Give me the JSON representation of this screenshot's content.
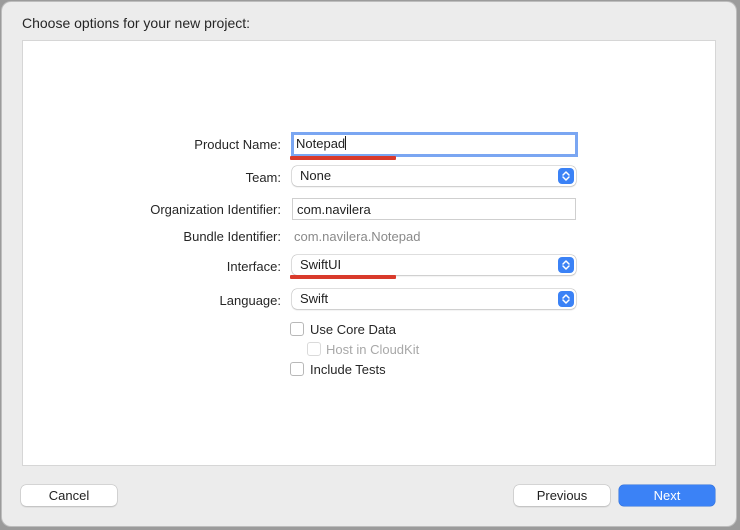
{
  "dialog": {
    "title": "Choose options for your new project:"
  },
  "form": {
    "product_name": {
      "label": "Product Name:",
      "value": "Notepad"
    },
    "team": {
      "label": "Team:",
      "value": "None"
    },
    "organization_identifier": {
      "label": "Organization Identifier:",
      "value": "com.navilera"
    },
    "bundle_identifier": {
      "label": "Bundle Identifier:",
      "value": "com.navilera.Notepad"
    },
    "interface": {
      "label": "Interface:",
      "value": "SwiftUI"
    },
    "language": {
      "label": "Language:",
      "value": "Swift"
    },
    "options": {
      "use_core_data": {
        "label": "Use Core Data",
        "checked": false
      },
      "host_in_cloudkit": {
        "label": "Host in CloudKit",
        "checked": false,
        "enabled": false
      },
      "include_tests": {
        "label": "Include Tests",
        "checked": false
      }
    }
  },
  "buttons": {
    "cancel": "Cancel",
    "previous": "Previous",
    "next": "Next"
  },
  "colors": {
    "accent": "#3b82f6",
    "annotation": "#d93a2b",
    "focus_ring": "#7aa6f2"
  },
  "icons": {
    "popup_arrows": "chevron-up-down-icon"
  }
}
